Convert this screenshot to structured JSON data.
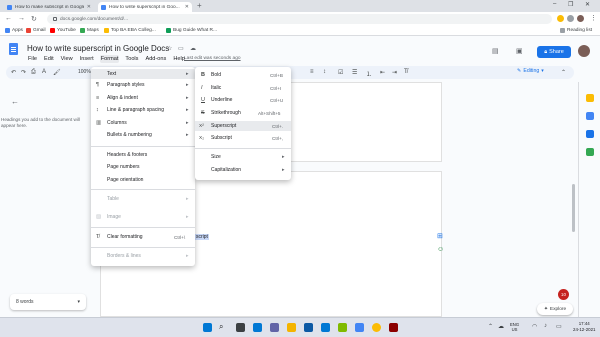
{
  "browser": {
    "tabs": [
      {
        "title": "How to make subscript in Google ..."
      },
      {
        "title": "How to write superscript in Goo..."
      }
    ],
    "new_tab_label": "+",
    "url": "docs.google.com/document/d/...",
    "bookmarks": [
      {
        "label": "Apps"
      },
      {
        "label": "Gmail"
      },
      {
        "label": "YouTube"
      },
      {
        "label": "Maps"
      },
      {
        "label": "Top BA EBA Colleg..."
      },
      {
        "label": "Bug Guide What R..."
      }
    ],
    "reading_list": "Reading list"
  },
  "docs": {
    "title": "How to write superscript in Google Docs",
    "menus": [
      "File",
      "Edit",
      "View",
      "Insert",
      "Format",
      "Tools",
      "Add-ons",
      "Help"
    ],
    "active_menu": "Format",
    "last_edit": "Last edit was seconds ago",
    "share_label": "Share",
    "zoom": "100%",
    "editing_mode": "Editing",
    "outline_hint": "Headings you add to the document will appear here.",
    "doc_fragment": "script",
    "word_count": "8 words",
    "explore_label": "Explore",
    "badge_count": "10"
  },
  "format_menu": {
    "items": [
      {
        "label": "Text",
        "has_submenu": true,
        "highlighted": true,
        "icon": "text-icon"
      },
      {
        "label": "Paragraph styles",
        "has_submenu": true,
        "icon": "paragraph-icon"
      },
      {
        "label": "Align & indent",
        "has_submenu": true,
        "icon": "align-icon"
      },
      {
        "label": "Line & paragraph spacing",
        "has_submenu": true,
        "icon": "spacing-icon"
      },
      {
        "label": "Columns",
        "has_submenu": true,
        "icon": "columns-icon"
      },
      {
        "label": "Bullets & numbering",
        "has_submenu": true,
        "icon": "bullets-icon"
      },
      {
        "label": "Headers & footers",
        "has_submenu": false,
        "icon": ""
      },
      {
        "label": "Page numbers",
        "has_submenu": false,
        "icon": ""
      },
      {
        "label": "Page orientation",
        "has_submenu": false,
        "icon": ""
      },
      {
        "label": "Table",
        "has_submenu": true,
        "disabled": true,
        "icon": ""
      },
      {
        "label": "Image",
        "has_submenu": true,
        "disabled": true,
        "icon": "image-icon"
      },
      {
        "label": "Clear formatting",
        "shortcut": "Ctrl+\\",
        "icon": "clear-format-icon"
      },
      {
        "label": "Borders & lines",
        "has_submenu": true,
        "disabled": true,
        "icon": ""
      }
    ]
  },
  "text_submenu": {
    "items": [
      {
        "label": "Bold",
        "shortcut": "Ctrl+B",
        "icon": "B"
      },
      {
        "label": "Italic",
        "shortcut": "Ctrl+I",
        "icon": "I"
      },
      {
        "label": "Underline",
        "shortcut": "Ctrl+U",
        "icon": "U"
      },
      {
        "label": "Strikethrough",
        "shortcut": "Alt+Shift+5",
        "icon": "S"
      },
      {
        "label": "Superscript",
        "shortcut": "Ctrl+.",
        "icon": "X²",
        "highlighted": true
      },
      {
        "label": "Subscript",
        "shortcut": "Ctrl+,",
        "icon": "X₂"
      },
      {
        "label": "Size",
        "has_submenu": true
      },
      {
        "label": "Capitalization",
        "has_submenu": true
      }
    ]
  },
  "taskbar": {
    "lang": "ENG",
    "lang_sub": "US",
    "time": "17:44",
    "date": "24-12-2021"
  }
}
